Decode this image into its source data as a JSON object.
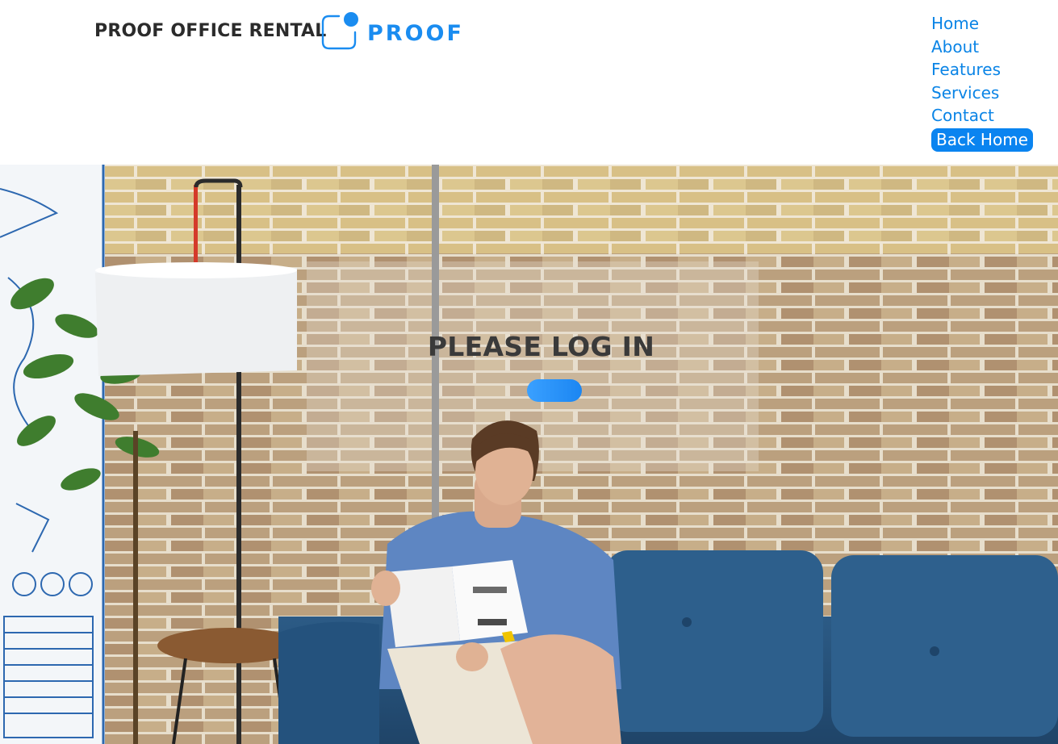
{
  "header": {
    "brand_text": "PROOF OFFICE RENTAL",
    "logo_text": "PROOF"
  },
  "nav": {
    "items": [
      {
        "label": "Home"
      },
      {
        "label": "About"
      },
      {
        "label": "Features"
      },
      {
        "label": "Services"
      },
      {
        "label": "Contact"
      }
    ],
    "back_home_label": "Back Home"
  },
  "hero": {
    "title": "PLEASE LOG IN",
    "button_label": ""
  },
  "colors": {
    "accent": "#0a84e6",
    "button": "#1b86f2",
    "heading": "#3a3a3a"
  }
}
